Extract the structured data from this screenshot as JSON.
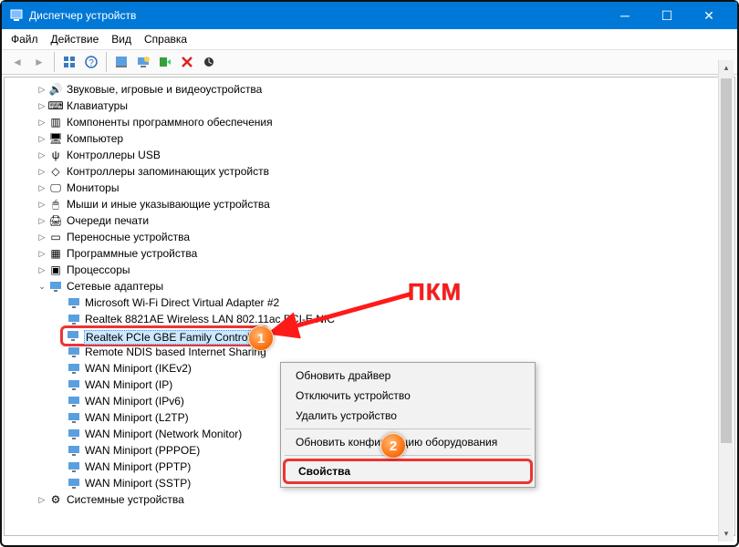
{
  "window": {
    "title": "Диспетчер устройств"
  },
  "menu": {
    "file": "Файл",
    "action": "Действие",
    "view": "Вид",
    "help": "Справка"
  },
  "tree": {
    "sound": "Звуковые, игровые и видеоустройства",
    "keyboards": "Клавиатуры",
    "software": "Компоненты программного обеспечения",
    "computer": "Компьютер",
    "usb": "Контроллеры USB",
    "storage": "Контроллеры запоминающих устройств",
    "monitors": "Мониторы",
    "hid": "Мыши и иные указывающие устройства",
    "printq": "Очереди печати",
    "portable": "Переносные устройства",
    "firmware": "Программные устройства",
    "cpu": "Процессоры",
    "network": "Сетевые адаптеры",
    "netItems": {
      "wifi_direct": "Microsoft Wi-Fi Direct Virtual Adapter #2",
      "realtek_wlan": "Realtek 8821AE Wireless LAN 802.11ac PCI-E NIC",
      "realtek_gbe": "Realtek PCIe GBE Family Controller",
      "rndis": "Remote NDIS based Internet Sharing",
      "wan_ikev2": "WAN Miniport (IKEv2)",
      "wan_ip": "WAN Miniport (IP)",
      "wan_ipv6": "WAN Miniport (IPv6)",
      "wan_l2tp": "WAN Miniport (L2TP)",
      "wan_netmon": "WAN Miniport (Network Monitor)",
      "wan_pppoe": "WAN Miniport (PPPOE)",
      "wan_pptp": "WAN Miniport (PPTP)",
      "wan_sstp": "WAN Miniport (SSTP)"
    },
    "system": "Системные устройства"
  },
  "context": {
    "update": "Обновить драйвер",
    "disable": "Отключить устройство",
    "remove": "Удалить устройство",
    "scan": "Обновить конфигурацию оборудования",
    "props": "Свойства"
  },
  "annotations": {
    "pkm": "ПКМ",
    "badge1": "1",
    "badge2": "2"
  }
}
